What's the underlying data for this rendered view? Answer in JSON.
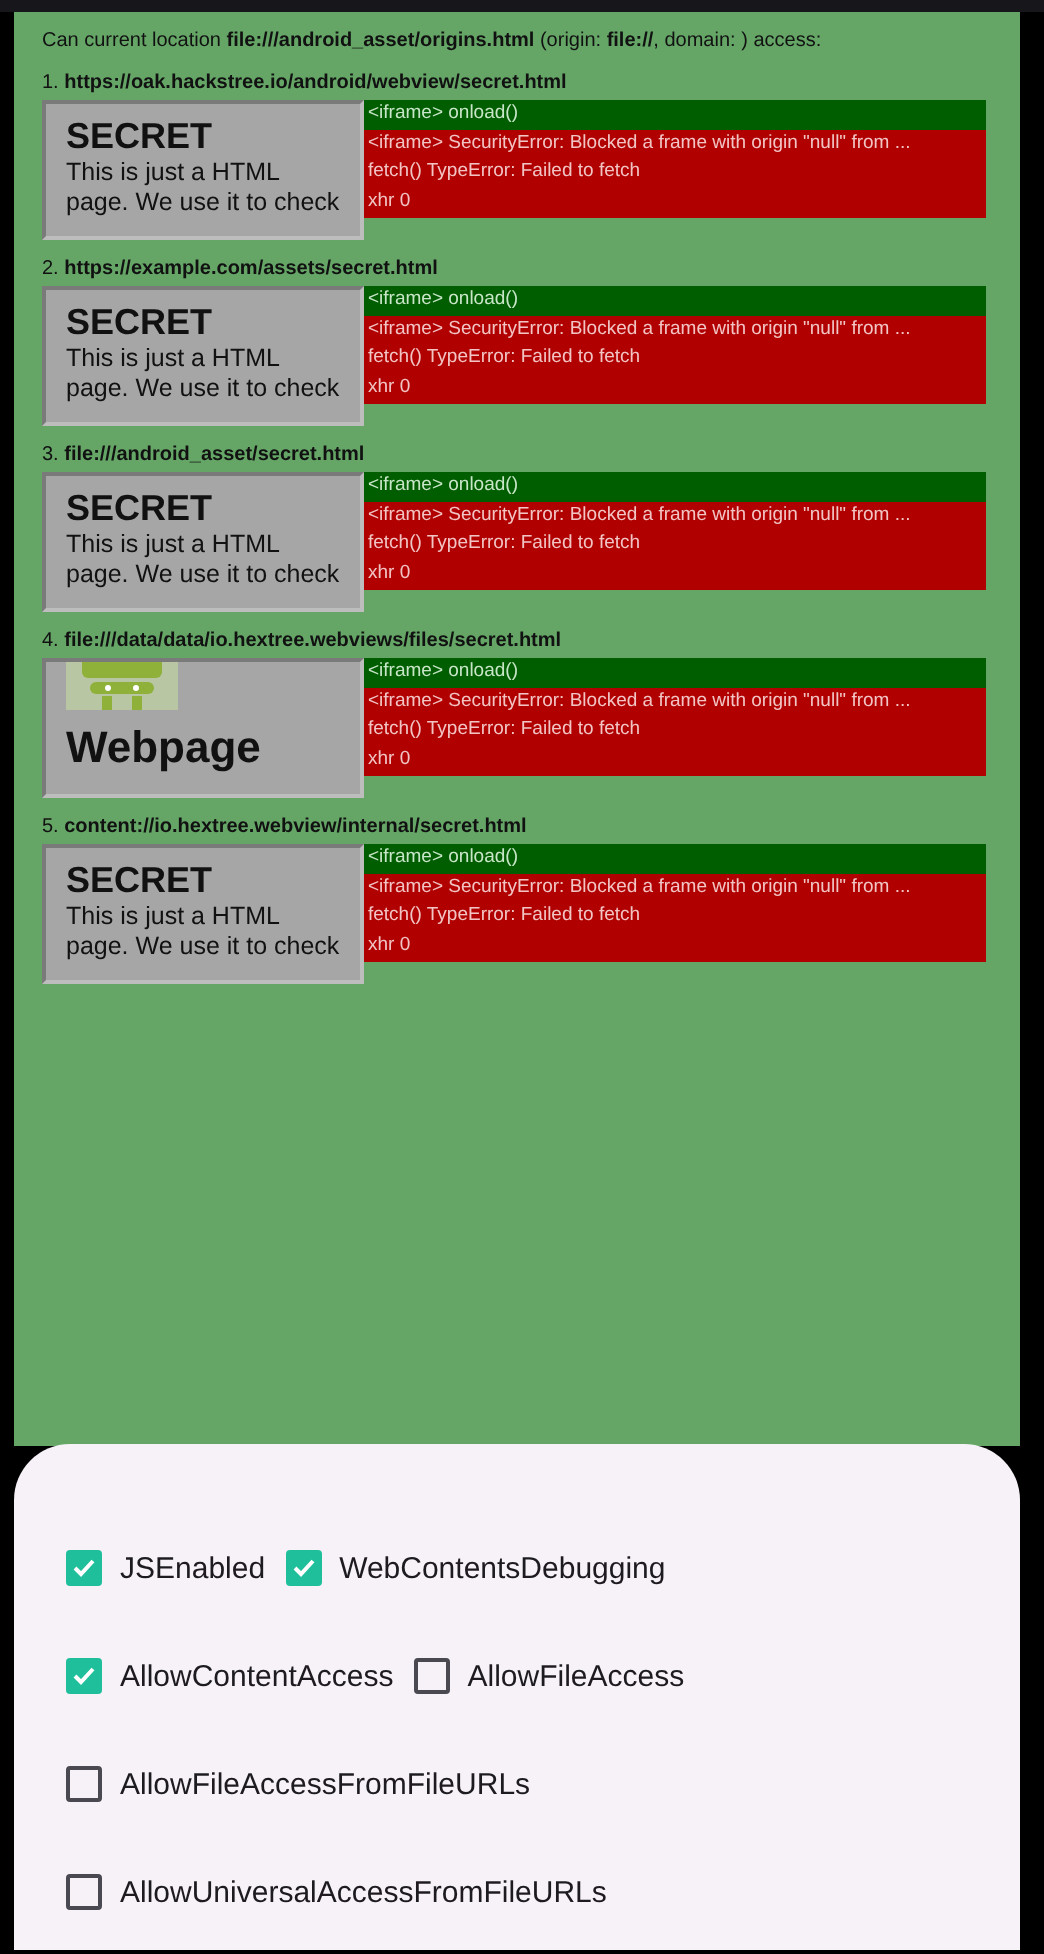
{
  "header": "Can current location **file:///android_asset/origins.html** (origin: **file://**, domain: ) access:",
  "targets": [
    {
      "label": "1. **https://oak.hackstree.io/android/webview/secret.html**",
      "preview": {
        "kind": "text-page",
        "heading": "SECRET",
        "body": [
          "This is just a HTML",
          "page. We use it to check"
        ]
      },
      "log": [
        {
          "kind": "ok",
          "text": "<iframe> onload()"
        },
        {
          "kind": "error",
          "text": "<iframe> SecurityError: Blocked a frame with origin \"null\" from ..."
        },
        {
          "kind": "error",
          "text": "fetch() TypeError: Failed to fetch"
        },
        {
          "kind": "error",
          "text": "xhr 0"
        }
      ]
    },
    {
      "label": "2. **https://example.com/assets/secret.html**",
      "preview": {
        "kind": "text-page",
        "heading": "SECRET",
        "body": [
          "This is just a HTML",
          "page. We use it to check"
        ]
      },
      "log": [
        {
          "kind": "ok",
          "text": "<iframe> onload()"
        },
        {
          "kind": "error",
          "text": "<iframe> SecurityError: Blocked a frame with origin \"null\" from ..."
        },
        {
          "kind": "error",
          "text": "fetch() TypeError: Failed to fetch"
        },
        {
          "kind": "error",
          "text": "xhr 0"
        }
      ]
    },
    {
      "label": "3. **file:///android_asset/secret.html**",
      "preview": {
        "kind": "text-page",
        "heading": "SECRET",
        "body": [
          "This is just a HTML",
          "page. We use it to check"
        ]
      },
      "log": [
        {
          "kind": "ok",
          "text": "<iframe> onload()"
        },
        {
          "kind": "error",
          "text": "<iframe> SecurityError: Blocked a frame with origin \"null\" from ..."
        },
        {
          "kind": "error",
          "text": "fetch() TypeError: Failed to fetch"
        },
        {
          "kind": "error",
          "text": "xhr 0"
        }
      ]
    },
    {
      "label": "4. **file:///data/data/io.hextree.webviews/files/secret.html**",
      "preview": {
        "kind": "image-page",
        "heading": "Webpage"
      },
      "log": [
        {
          "kind": "ok",
          "text": "<iframe> onload()"
        },
        {
          "kind": "error",
          "text": "<iframe> SecurityError: Blocked a frame with origin \"null\" from ..."
        },
        {
          "kind": "error",
          "text": "fetch() TypeError: Failed to fetch"
        },
        {
          "kind": "error",
          "text": "xhr 0"
        }
      ]
    },
    {
      "label": "5. **content://io.hextree.webview/internal/secret.html**",
      "preview": {
        "kind": "text-page",
        "heading": "SECRET",
        "body": [
          "This is just a HTML",
          "page. We use it to check"
        ]
      },
      "log": [
        {
          "kind": "ok",
          "text": "<iframe> onload()"
        },
        {
          "kind": "error",
          "text": "<iframe> SecurityError: Blocked a frame with origin \"null\" from ..."
        },
        {
          "kind": "error",
          "text": "fetch() TypeError: Failed to fetch"
        },
        {
          "kind": "error",
          "text": "xhr 0"
        }
      ]
    }
  ],
  "settings": {
    "rows": [
      {
        "options": [
          {
            "label": "JSEnabled",
            "checked": true
          },
          {
            "label": "WebContentsDebugging",
            "checked": true
          }
        ]
      },
      {
        "options": [
          {
            "label": "AllowContentAccess",
            "checked": true
          },
          {
            "label": "AllowFileAccess",
            "checked": false
          }
        ]
      },
      {
        "options": [
          {
            "label": "AllowFileAccessFromFileURLs",
            "checked": false
          }
        ]
      },
      {
        "options": [
          {
            "label": "AllowUniversalAccessFromFileURLs",
            "checked": false
          }
        ]
      }
    ]
  }
}
